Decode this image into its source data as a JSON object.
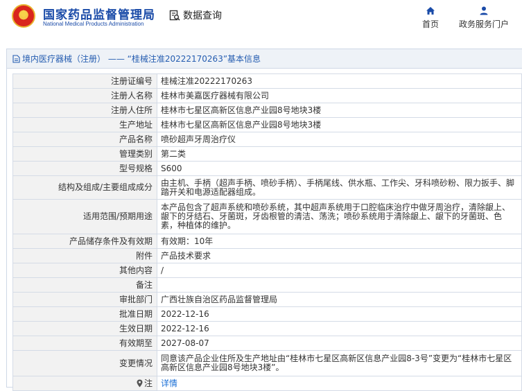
{
  "header": {
    "brand_cn": "国家药品监督管理局",
    "brand_en": "National Medical Products Administration",
    "data_query": "数据查询",
    "nav_home": "首页",
    "nav_services": "政务服务门户"
  },
  "panel": {
    "title": "境内医疗器械（注册） —— “桂械注准20222170263”基本信息"
  },
  "rows": [
    {
      "label": "注册证编号",
      "value": "桂械注准20222170263"
    },
    {
      "label": "注册人名称",
      "value": "桂林市美嘉医疗器械有限公司"
    },
    {
      "label": "注册人住所",
      "value": "桂林市七星区高新区信息产业园8号地块3楼"
    },
    {
      "label": "生产地址",
      "value": "桂林市七星区高新区信息产业园8号地块3楼"
    },
    {
      "label": "产品名称",
      "value": "喷砂超声牙周治疗仪"
    },
    {
      "label": "管理类别",
      "value": "第二类"
    },
    {
      "label": "型号规格",
      "value": "S600"
    },
    {
      "label": "结构及组成/主要组成成分",
      "value": "由主机、手柄（超声手柄、喷砂手柄）、手柄尾线、供水瓶、工作尖、牙科喷砂粉、限力扳手、脚踏开关和电源适配器组成。"
    },
    {
      "label": "适用范围/预期用途",
      "value": "本产品包含了超声系统和喷砂系统，其中超声系统用于口腔临床治疗中做牙周治疗，清除龈上、龈下的牙结石、牙菌斑，牙齿根管的清洁、荡洗；喷砂系统用于清除龈上、龈下的牙菌斑、色素，种植体的维护。"
    },
    {
      "label": "产品储存条件及有效期",
      "value": "有效期：10年"
    },
    {
      "label": "附件",
      "value": "产品技术要求"
    },
    {
      "label": "其他内容",
      "value": "/"
    },
    {
      "label": "备注",
      "value": ""
    },
    {
      "label": "审批部门",
      "value": "广西壮族自治区药品监督管理局"
    },
    {
      "label": "批准日期",
      "value": "2022-12-16"
    },
    {
      "label": "生效日期",
      "value": "2022-12-16"
    },
    {
      "label": "有效期至",
      "value": "2027-08-07"
    },
    {
      "label": "变更情况",
      "value": "同意该产品企业住所及生产地址由“桂林市七星区高新区信息产业园8-3号”变更为“桂林市七星区高新区信息产业园8号地块3楼”。"
    },
    {
      "label": "注",
      "value": "详情"
    }
  ]
}
